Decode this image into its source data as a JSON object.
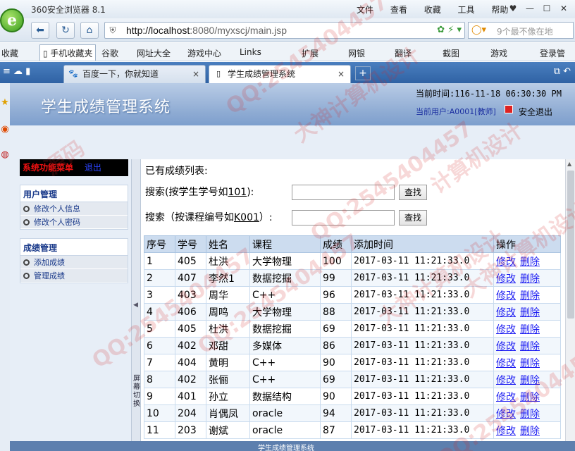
{
  "browser": {
    "app_title": "360安全浏览器 8.1",
    "menu": [
      "文件",
      "查看",
      "收藏",
      "工具",
      "帮助"
    ],
    "url_host": "http://localhost",
    "url_rest": ":8080/myxscj/main.jsp",
    "search_placeholder": "9个最不像在地",
    "favorites": [
      "收藏",
      "手机收藏夹",
      "谷歌",
      "网址大全",
      "游戏中心",
      "Links",
      "扩展",
      "网银",
      "翻译",
      "截图",
      "游戏",
      "登录管"
    ],
    "tabs": [
      {
        "title": "百度一下，你就知道",
        "close": "×"
      },
      {
        "title": "学生成绩管理系统",
        "close": "×"
      }
    ],
    "new_tab": "+"
  },
  "header": {
    "title": "学生成绩管理系统",
    "time_label": "当前时间:116-11-18 06:30:30 PM",
    "user_label": "当前用户:A0001[教师]",
    "logout": "安全退出"
  },
  "menu": {
    "head_title": "系统功能菜单",
    "head_exit": "退出",
    "groups": [
      {
        "title": "用户管理",
        "items": [
          "修改个人信息",
          "修改个人密码"
        ]
      },
      {
        "title": "成绩管理",
        "items": [
          "添加成绩",
          "管理成绩"
        ]
      }
    ]
  },
  "splitter": {
    "text": "屏幕切换"
  },
  "content": {
    "list_title": "已有成绩列表:",
    "search1_prefix": "搜索(按学生学号如",
    "search1_example": "101",
    "search1_suffix": "):",
    "search2_prefix": "搜索（按课程编号如",
    "search2_example": "K001",
    "search2_suffix": "）:",
    "search_button": "查找",
    "columns": [
      "序号",
      "学号",
      "姓名",
      "课程",
      "成绩",
      "添加时间",
      "操作"
    ],
    "edit_label": "修改",
    "delete_label": "删除",
    "rows": [
      [
        "1",
        "405",
        "杜洪",
        "大学物理",
        "100",
        "2017-03-11 11:21:33.0"
      ],
      [
        "2",
        "407",
        "李然1",
        "数据挖掘",
        "99",
        "2017-03-11 11:21:33.0"
      ],
      [
        "3",
        "403",
        "周华",
        "C++",
        "96",
        "2017-03-11 11:21:33.0"
      ],
      [
        "4",
        "406",
        "周鸣",
        "大学物理",
        "88",
        "2017-03-11 11:21:33.0"
      ],
      [
        "5",
        "405",
        "杜洪",
        "数据挖掘",
        "69",
        "2017-03-11 11:21:33.0"
      ],
      [
        "6",
        "402",
        "邓甜",
        "多媒体",
        "86",
        "2017-03-11 11:21:33.0"
      ],
      [
        "7",
        "404",
        "黄明",
        "C++",
        "90",
        "2017-03-11 11:21:33.0"
      ],
      [
        "8",
        "402",
        "张俪",
        "C++",
        "69",
        "2017-03-11 11:21:33.0"
      ],
      [
        "9",
        "401",
        "孙立",
        "数据结构",
        "90",
        "2017-03-11 11:21:33.0"
      ],
      [
        "10",
        "204",
        "肖偶凤",
        "oracle",
        "94",
        "2017-03-11 11:21:33.0"
      ],
      [
        "11",
        "203",
        "谢斌",
        "oracle",
        "87",
        "2017-03-11 11:21:33.0"
      ]
    ]
  },
  "footer": {
    "text": "学生成绩管理系统"
  },
  "watermarks": [
    "QQ:2545404457",
    "大神计算机设计",
    "源码",
    "QQ:2545404457",
    "计算机设计",
    "大神计算机设计",
    "QQ:2545404457",
    "QQ:2545404457",
    "大神计算机设计",
    "QQ:2545404457"
  ]
}
